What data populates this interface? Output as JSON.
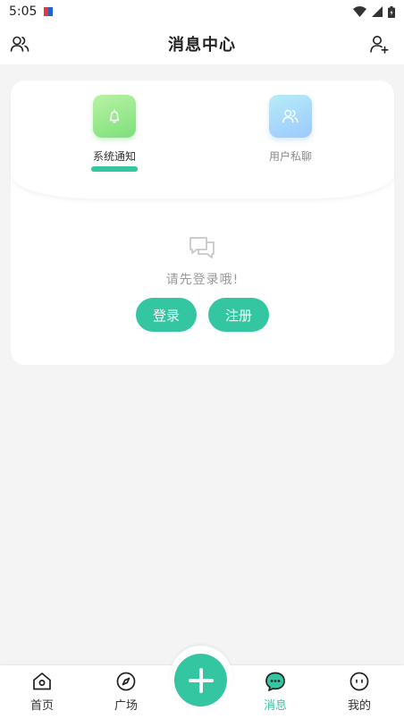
{
  "status_bar": {
    "time": "5:05"
  },
  "header": {
    "title": "消息中心"
  },
  "tabs": [
    {
      "label": "系统通知",
      "active": true,
      "icon": "bell-icon"
    },
    {
      "label": "用户私聊",
      "active": false,
      "icon": "users-icon"
    }
  ],
  "empty_state": {
    "message": "请先登录哦!",
    "icon": "chat-bubbles-icon"
  },
  "actions": {
    "login_label": "登录",
    "register_label": "注册"
  },
  "bottom_nav": {
    "items": [
      {
        "label": "首页",
        "icon": "home-icon",
        "active": false
      },
      {
        "label": "广场",
        "icon": "compass-icon",
        "active": false
      },
      {
        "label": "消息",
        "icon": "message-icon",
        "active": true
      },
      {
        "label": "我的",
        "icon": "face-icon",
        "active": false
      }
    ],
    "center_button": {
      "icon": "plus-icon"
    }
  },
  "colors": {
    "accent": "#34c6a0",
    "background": "#f4f4f4"
  }
}
